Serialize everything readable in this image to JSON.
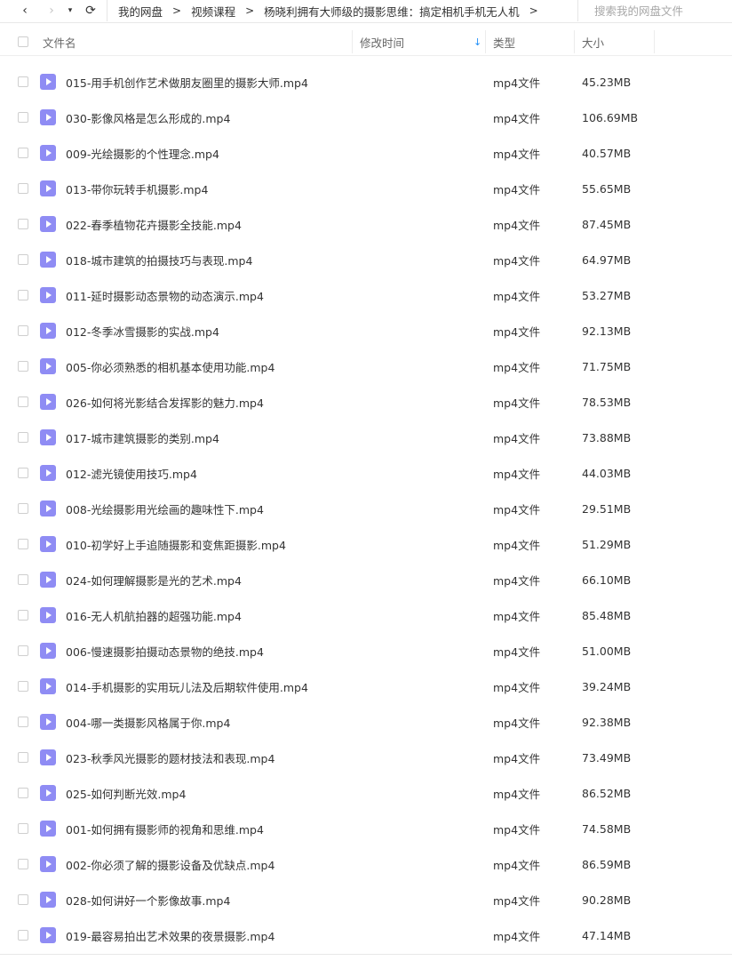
{
  "nav": {
    "back_icon": "‹",
    "forward_icon": "›",
    "history_icon": "▾",
    "refresh_icon": "⟳"
  },
  "breadcrumb": [
    "我的网盘",
    "视频课程",
    "杨晓利拥有大师级的摄影思维：搞定相机手机无人机"
  ],
  "breadcrumb_sep": ">",
  "search": {
    "placeholder": "搜索我的网盘文件"
  },
  "columns": {
    "name": "文件名",
    "modified": "修改时间",
    "type": "类型",
    "size": "大小",
    "sort_icon": "↓"
  },
  "accent_color": "#1f8ff7",
  "file_icon_color": "#8f8cf4",
  "files": [
    {
      "name": "015-用手机创作艺术做朋友圈里的摄影大师.mp4",
      "type": "mp4文件",
      "size": "45.23MB"
    },
    {
      "name": "030-影像风格是怎么形成的.mp4",
      "type": "mp4文件",
      "size": "106.69MB"
    },
    {
      "name": "009-光绘摄影的个性理念.mp4",
      "type": "mp4文件",
      "size": "40.57MB"
    },
    {
      "name": "013-带你玩转手机摄影.mp4",
      "type": "mp4文件",
      "size": "55.65MB"
    },
    {
      "name": "022-春季植物花卉摄影全技能.mp4",
      "type": "mp4文件",
      "size": "87.45MB"
    },
    {
      "name": "018-城市建筑的拍摄技巧与表现.mp4",
      "type": "mp4文件",
      "size": "64.97MB"
    },
    {
      "name": "011-延时摄影动态景物的动态演示.mp4",
      "type": "mp4文件",
      "size": "53.27MB"
    },
    {
      "name": "012-冬季冰雪摄影的实战.mp4",
      "type": "mp4文件",
      "size": "92.13MB"
    },
    {
      "name": "005-你必须熟悉的相机基本使用功能.mp4",
      "type": "mp4文件",
      "size": "71.75MB"
    },
    {
      "name": "026-如何将光影结合发挥影的魅力.mp4",
      "type": "mp4文件",
      "size": "78.53MB"
    },
    {
      "name": "017-城市建筑摄影的类别.mp4",
      "type": "mp4文件",
      "size": "73.88MB"
    },
    {
      "name": "012-滤光镜使用技巧.mp4",
      "type": "mp4文件",
      "size": "44.03MB"
    },
    {
      "name": "008-光绘摄影用光绘画的趣味性下.mp4",
      "type": "mp4文件",
      "size": "29.51MB"
    },
    {
      "name": "010-初学好上手追随摄影和变焦距摄影.mp4",
      "type": "mp4文件",
      "size": "51.29MB"
    },
    {
      "name": "024-如何理解摄影是光的艺术.mp4",
      "type": "mp4文件",
      "size": "66.10MB"
    },
    {
      "name": "016-无人机航拍器的超强功能.mp4",
      "type": "mp4文件",
      "size": "85.48MB"
    },
    {
      "name": "006-慢速摄影拍摄动态景物的绝技.mp4",
      "type": "mp4文件",
      "size": "51.00MB"
    },
    {
      "name": "014-手机摄影的实用玩儿法及后期软件使用.mp4",
      "type": "mp4文件",
      "size": "39.24MB"
    },
    {
      "name": "004-哪一类摄影风格属于你.mp4",
      "type": "mp4文件",
      "size": "92.38MB"
    },
    {
      "name": "023-秋季风光摄影的题材技法和表现.mp4",
      "type": "mp4文件",
      "size": "73.49MB"
    },
    {
      "name": "025-如何判断光效.mp4",
      "type": "mp4文件",
      "size": "86.52MB"
    },
    {
      "name": "001-如何拥有摄影师的视角和思维.mp4",
      "type": "mp4文件",
      "size": "74.58MB"
    },
    {
      "name": "002-你必须了解的摄影设备及优缺点.mp4",
      "type": "mp4文件",
      "size": "86.59MB"
    },
    {
      "name": "028-如何讲好一个影像故事.mp4",
      "type": "mp4文件",
      "size": "90.28MB"
    },
    {
      "name": "019-最容易拍出艺术效果的夜景摄影.mp4",
      "type": "mp4文件",
      "size": "47.14MB"
    }
  ]
}
